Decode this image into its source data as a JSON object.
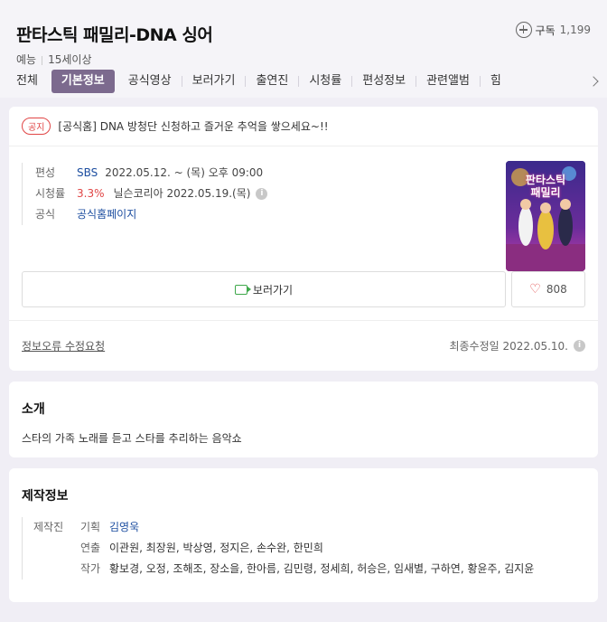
{
  "header": {
    "title": "판타스틱 패밀리-DNA 싱어",
    "genre": "예능",
    "rating": "15세이상",
    "subscribe_label": "구독",
    "subscribe_count": "1,199"
  },
  "tabs": [
    {
      "label": "전체",
      "active": false
    },
    {
      "label": "기본정보",
      "active": true
    },
    {
      "label": "공식영상",
      "active": false
    },
    {
      "label": "보러가기",
      "active": false
    },
    {
      "label": "출연진",
      "active": false
    },
    {
      "label": "시청률",
      "active": false
    },
    {
      "label": "편성정보",
      "active": false
    },
    {
      "label": "관련앨범",
      "active": false
    },
    {
      "label": "힘",
      "active": false
    }
  ],
  "notice": {
    "badge": "공지",
    "text": "[공식홈] DNA 방청단 신청하고 즐거운 추억을 쌓으세요~!!"
  },
  "info": {
    "schedule_label": "편성",
    "channel": "SBS",
    "schedule": "2022.05.12. ~ (목) 오후 09:00",
    "rating_label": "시청률",
    "rating_value": "3.3%",
    "rating_source": "닐슨코리아 2022.05.19.(목)",
    "official_label": "공식",
    "official_link": "공식홈페이지"
  },
  "poster": {
    "line1": "판타스틱",
    "line2": "패밀리"
  },
  "actions": {
    "watch_label": "보러가기",
    "like_count": "808"
  },
  "footer": {
    "report_label": "정보오류 수정요청",
    "updated": "최종수정일 2022.05.10."
  },
  "intro": {
    "title": "소개",
    "text": "스타의 가족 노래를 듣고 스타를 추리하는 음악쇼"
  },
  "production": {
    "title": "제작정보",
    "crew_label": "제작진",
    "rows": [
      {
        "label": "기획",
        "value": "김영욱"
      },
      {
        "label": "연출",
        "value": "이관원, 최장원, 박상영, 정지은, 손수완, 한민희"
      },
      {
        "label": "작가",
        "value": "황보경, 오정, 조해조, 장소을, 한아름, 김민령, 정세희, 허승은, 임새별, 구하연, 황윤주, 김지윤"
      }
    ]
  },
  "colors": {
    "active_tab": "#7c6a8e",
    "link_blue": "#1d4ea0",
    "accent_red": "#e04545",
    "watch_green": "#3ea84a"
  }
}
